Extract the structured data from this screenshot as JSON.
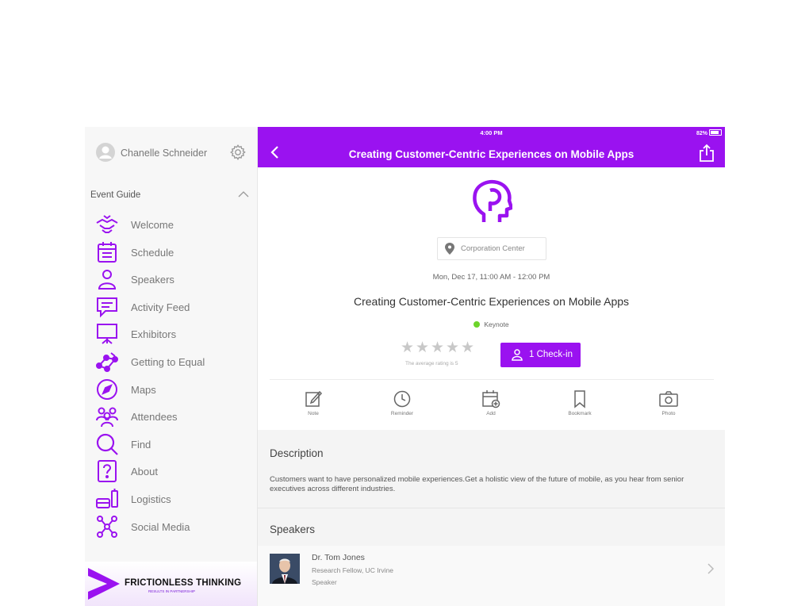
{
  "colors": {
    "accent": "#9a12f0",
    "keynote_dot": "#6dd42a"
  },
  "status_bar": {
    "time": "4:00 PM",
    "battery": "82%"
  },
  "sidebar": {
    "user_name": "Chanelle Schneider",
    "section_title": "Event Guide",
    "items": [
      {
        "label": "Welcome",
        "icon": "handshake-icon"
      },
      {
        "label": "Schedule",
        "icon": "calendar-icon"
      },
      {
        "label": "Speakers",
        "icon": "person-icon"
      },
      {
        "label": "Activity Feed",
        "icon": "chat-icon"
      },
      {
        "label": "Exhibitors",
        "icon": "easel-icon"
      },
      {
        "label": "Getting to Equal",
        "icon": "network-icon"
      },
      {
        "label": "Maps",
        "icon": "compass-icon"
      },
      {
        "label": "Attendees",
        "icon": "people-icon"
      },
      {
        "label": "Find",
        "icon": "search-icon"
      },
      {
        "label": "About",
        "icon": "question-icon"
      },
      {
        "label": "Logistics",
        "icon": "bus-icon"
      },
      {
        "label": "Social Media",
        "icon": "share-nodes-icon"
      }
    ],
    "logo_text": "FRICTIONLESS THINKING",
    "logo_subtext": "RESULTS IN PARTNERSHIP"
  },
  "header": {
    "title": "Creating Customer-Centric Experiences on Mobile Apps"
  },
  "session": {
    "location": "Corporation Center",
    "time": "Mon, Dec 17, 11:00 AM - 12:00 PM",
    "title": "Creating Customer-Centric Experiences on Mobile Apps",
    "track": "Keynote",
    "rating_note": "The average rating is 5",
    "checkin_label": "1 Check-in"
  },
  "actions": [
    {
      "label": "Note",
      "icon": "note-icon"
    },
    {
      "label": "Reminder",
      "icon": "clock-icon"
    },
    {
      "label": "Add",
      "icon": "calendar-add-icon"
    },
    {
      "label": "Bookmark",
      "icon": "bookmark-icon"
    },
    {
      "label": "Photo",
      "icon": "camera-icon"
    }
  ],
  "description": {
    "heading": "Description",
    "body": "Customers want to have personalized mobile experiences.Get a holistic view of the future of mobile, as you hear from senior executives across different industries."
  },
  "speakers": {
    "heading": "Speakers",
    "items": [
      {
        "name": "Dr. Tom Jones",
        "role": "Research Fellow, UC Irvine",
        "type": "Speaker"
      }
    ]
  }
}
